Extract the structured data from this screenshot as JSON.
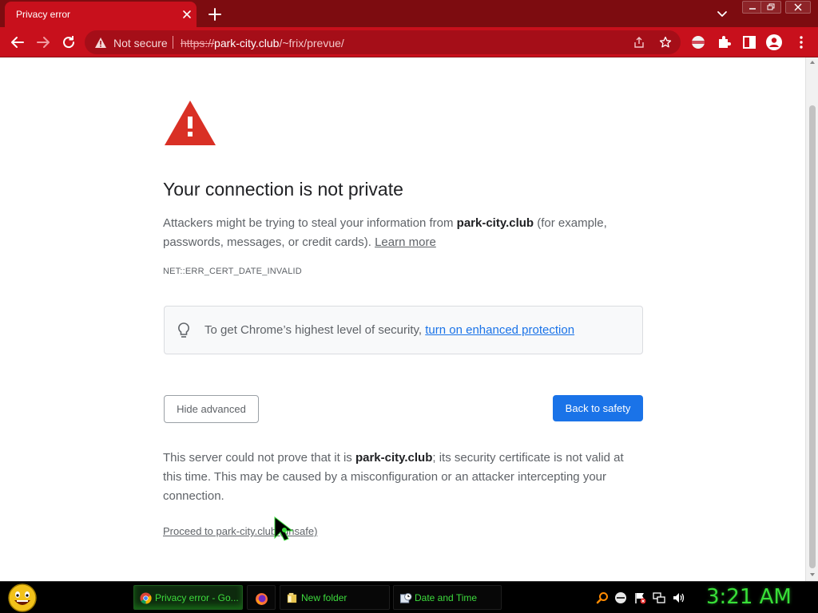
{
  "tab": {
    "title": "Privacy error"
  },
  "toolbar": {
    "security_label": "Not secure",
    "url_scheme": "https://",
    "url_host": "park-city.club",
    "url_path": "/~frix/prevue/"
  },
  "page": {
    "heading": "Your connection is not private",
    "para1_before": "Attackers might be trying to steal your information from ",
    "para1_host": "park-city.club",
    "para1_after": " (for example, passwords, messages, or credit cards). ",
    "learn_more": "Learn more",
    "error_code": "NET::ERR_CERT_DATE_INVALID",
    "protection_text": "To get Chrome’s highest level of security, ",
    "protection_link": "turn on enhanced protection",
    "hide_advanced": "Hide advanced",
    "back_to_safety": "Back to safety",
    "para2_before": "This server could not prove that it is ",
    "para2_host": "park-city.club",
    "para2_after": "; its security certificate is not valid at this time. This may be caused by a misconfiguration or an attacker intercepting your connection.",
    "proceed_link": "Proceed to park-city.club (unsafe)"
  },
  "taskbar": {
    "tasks": [
      {
        "label": "Privacy error - Go...",
        "icon": "chrome-icon",
        "active": true
      },
      {
        "label": "",
        "icon": "firefox-icon",
        "active": false
      },
      {
        "label": "New folder",
        "icon": "folder-icon",
        "active": false
      },
      {
        "label": "Date and Time",
        "icon": "datetime-icon",
        "active": false
      }
    ],
    "clock": "3:21 AM"
  },
  "colors": {
    "frame_dark": "#7d0c10",
    "frame": "#c8101c",
    "warning_red": "#d93025",
    "primary_blue": "#1a73e8",
    "clock_green": "#38e038"
  }
}
